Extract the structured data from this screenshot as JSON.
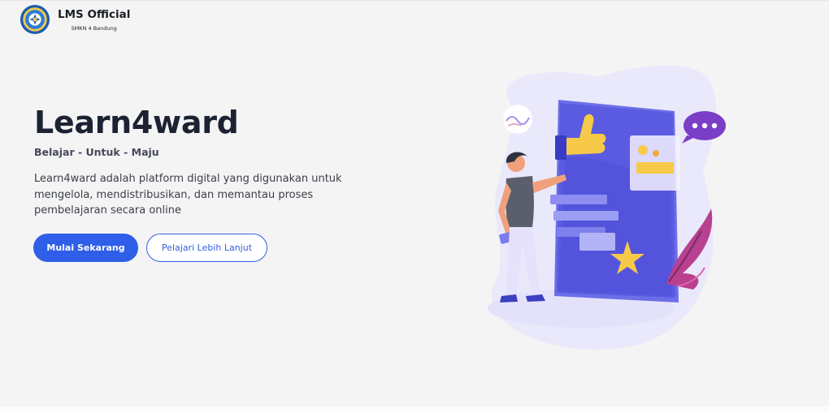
{
  "header": {
    "title": "LMS Official",
    "subtitle": "SMKN 4 Bandung",
    "logo_icon": "school-emblem-icon"
  },
  "hero": {
    "title": "Learn4ward",
    "tagline": "Belajar - Untuk - Maju",
    "description": "Learn4ward adalah platform digital yang digunakan untuk mengelola, mendistribusikan, dan memantau proses pembelajaran secara online",
    "primary_button": "Mulai Sekarang",
    "secondary_button": "Pelajari Lebih Lanjut"
  },
  "illustration": {
    "icons": [
      "thumbs-up-icon",
      "chat-bubble-icon",
      "star-icon",
      "chart-icon",
      "person-icon",
      "plant-icon"
    ]
  },
  "colors": {
    "accent": "#2f5fe8",
    "text_dark": "#1d2233",
    "background": "#f4f4f4"
  }
}
